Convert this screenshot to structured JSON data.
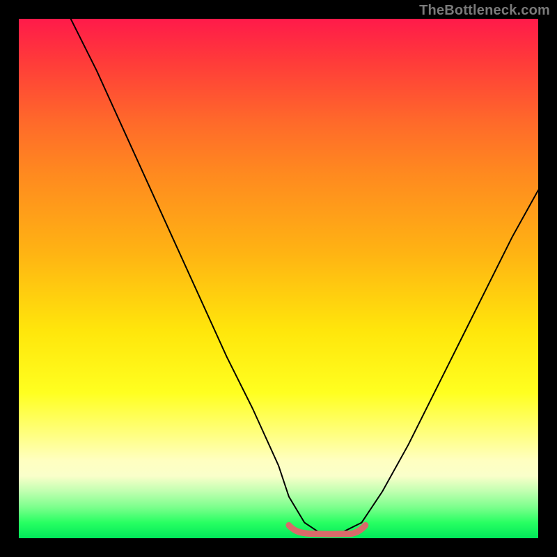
{
  "watermark": "TheBottleneck.com",
  "chart_data": {
    "type": "line",
    "title": "",
    "xlabel": "",
    "ylabel": "",
    "xlim": [
      0,
      100
    ],
    "ylim": [
      0,
      100
    ],
    "series": [
      {
        "name": "bottleneck-curve",
        "x": [
          10,
          15,
          20,
          25,
          30,
          35,
          40,
          45,
          50,
          52,
          55,
          58,
          60,
          62,
          66,
          70,
          75,
          80,
          85,
          90,
          95,
          100
        ],
        "y": [
          100,
          90,
          79,
          68,
          57,
          46,
          35,
          25,
          14,
          8,
          3,
          1,
          1,
          1,
          3,
          9,
          18,
          28,
          38,
          48,
          58,
          67
        ]
      },
      {
        "name": "optimal-range-marker",
        "x": [
          52,
          54,
          56,
          58,
          60,
          62,
          64,
          66
        ],
        "y": [
          2.5,
          1.4,
          1.0,
          0.9,
          0.9,
          1.0,
          1.4,
          2.5
        ]
      }
    ],
    "colors": {
      "curve": "#000000",
      "marker": "#d96a6a"
    }
  }
}
